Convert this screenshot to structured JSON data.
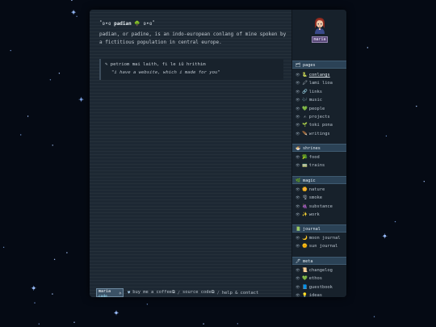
{
  "colors": {
    "background": "#050a14",
    "panel": "#1d2833",
    "sidebar": "#17212b",
    "section_header": "#2b4256",
    "name_badge": "#5a4a79"
  },
  "header": {
    "deco_left": "˚ʚ•ɞ",
    "word": "padian",
    "tree_icon": "🌳",
    "deco_right": "ʚ•ɞ˚"
  },
  "intro": "padian, or padine, is an indo-european conlang of mine spoken by a fictitious population in central europe.",
  "quote": {
    "icon": "✎",
    "text": "petriom mai laith, fi le iû hrithim",
    "translation": "\"i have a website, which i made for you\""
  },
  "footer": {
    "badge_top": "maria",
    "badge_bottom": "code",
    "heart_icon": "♥",
    "coffee": "buy me a coffee",
    "ext_icon": "⧉",
    "source": "source code",
    "help": "help & contact",
    "separator": "/"
  },
  "sidebar": {
    "avatar_name": "maria",
    "sections": [
      {
        "title": "pages",
        "icon": "🗂",
        "items": [
          {
            "label": "conlangs",
            "icon": "🐍",
            "active": true
          },
          {
            "label": "lami lioa",
            "icon": "🖍",
            "active": false
          },
          {
            "label": "links",
            "icon": "🔗",
            "active": false
          },
          {
            "label": "music",
            "icon": "🎶",
            "active": false
          },
          {
            "label": "people",
            "icon": "💚",
            "active": false
          },
          {
            "label": "projects",
            "icon": "✍",
            "active": false
          },
          {
            "label": "toki pona",
            "icon": "🌱",
            "active": false
          },
          {
            "label": "writings",
            "icon": "🪶",
            "active": false
          }
        ]
      },
      {
        "title": "shrines",
        "icon": "🍜",
        "items": [
          {
            "label": "food",
            "icon": "🥦",
            "active": false
          },
          {
            "label": "trains",
            "icon": "🚃",
            "active": false
          }
        ]
      },
      {
        "title": "magic",
        "icon": "🌿",
        "items": [
          {
            "label": "nature",
            "icon": "🌼",
            "active": false
          },
          {
            "label": "smoke",
            "icon": "🌪",
            "active": false
          },
          {
            "label": "substance",
            "icon": "🍇",
            "active": false
          },
          {
            "label": "work",
            "icon": "✨",
            "active": false
          }
        ]
      },
      {
        "title": "journal",
        "icon": "📗",
        "items": [
          {
            "label": "moon journal",
            "icon": "🌙",
            "active": false
          },
          {
            "label": "sun journal",
            "icon": "🌞",
            "active": false
          }
        ]
      },
      {
        "title": "meta",
        "icon": "🖊",
        "items": [
          {
            "label": "changelog",
            "icon": "📜",
            "active": false
          },
          {
            "label": "ethos",
            "icon": "💚",
            "active": false
          },
          {
            "label": "guestbook",
            "icon": "📘",
            "active": false
          },
          {
            "label": "ideas",
            "icon": "💡",
            "active": false
          }
        ]
      }
    ]
  }
}
